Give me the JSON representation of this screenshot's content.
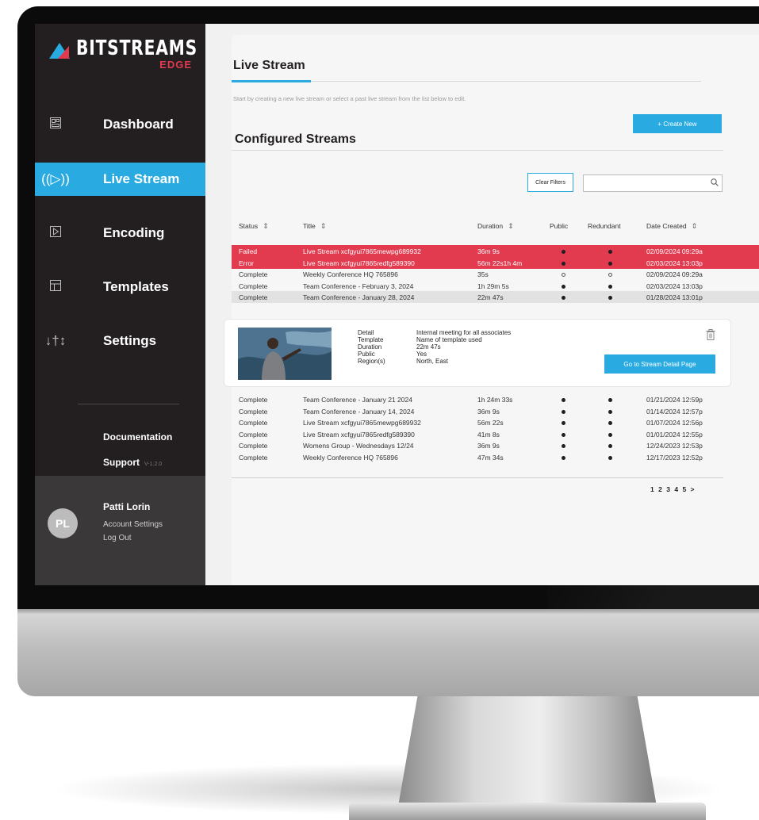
{
  "brand": {
    "name": "BITSTREAMS",
    "sub": "EDGE"
  },
  "nav": [
    {
      "label": "Dashboard",
      "icon": "dashboard-icon"
    },
    {
      "label": "Live Stream",
      "icon": "broadcast-icon"
    },
    {
      "label": "Encoding",
      "icon": "play-icon"
    },
    {
      "label": "Templates",
      "icon": "templates-icon"
    },
    {
      "label": "Settings",
      "icon": "sliders-icon"
    }
  ],
  "sidebar_links": {
    "documentation": "Documentation",
    "support": "Support",
    "version": "V-1.2.0"
  },
  "user": {
    "initials": "PL",
    "name": "Patti Lorin",
    "account_settings": "Account Settings",
    "logout": "Log Out"
  },
  "page": {
    "title": "Live Stream",
    "intro": "Start by creating a new live stream or select a past live stream from the list below to edit.",
    "create_button": "+ Create New",
    "section_title": "Configured Streams",
    "clear_filters": "Clear Filters",
    "search_placeholder": ""
  },
  "table": {
    "columns": [
      "Status",
      "Title",
      "Duration",
      "Public",
      "Redundant",
      "Date Created"
    ],
    "rows": [
      {
        "status": "Failed",
        "title": "Live Stream xcfgyui7865mewpg689932",
        "duration": "36m 9s",
        "public": "filled",
        "redundant": "filled",
        "date": "02/09/2024  09:29a",
        "state": "error"
      },
      {
        "status": "Error",
        "title": "Live Stream xcfgyui7865redfg589390",
        "duration": "56m 22s1h 4m",
        "public": "filled",
        "redundant": "filled",
        "date": "02/03/2024 13:03p",
        "state": "error"
      },
      {
        "status": "Complete",
        "title": "Weekly Conference HQ 765896",
        "duration": "35s",
        "public": "hollow",
        "redundant": "hollow",
        "date": "02/09/2024  09:29a",
        "state": "normal"
      },
      {
        "status": "Complete",
        "title": "Team Conference - February 3, 2024",
        "duration": "1h 29m 5s",
        "public": "filled",
        "redundant": "filled",
        "date": "02/03/2024 13:03p",
        "state": "normal"
      },
      {
        "status": "Complete",
        "title": "Team Conference - January 28, 2024",
        "duration": "22m 47s",
        "public": "filled",
        "redundant": "filled",
        "date": "01/28/2024 13:01p",
        "state": "selected"
      }
    ],
    "rows_after": [
      {
        "status": "Complete",
        "title": "Team Conference - January 21 2024",
        "duration": "1h 24m 33s",
        "public": "filled",
        "redundant": "filled",
        "date": "01/21/2024 12:59p"
      },
      {
        "status": "Complete",
        "title": "Team Conference - January 14, 2024",
        "duration": "36m 9s",
        "public": "filled",
        "redundant": "filled",
        "date": "01/14/2024 12:57p"
      },
      {
        "status": "Complete",
        "title": "Live Stream xcfgyui7865mewpg689932",
        "duration": "56m 22s",
        "public": "filled",
        "redundant": "filled",
        "date": "01/07/2024 12:56p"
      },
      {
        "status": "Complete",
        "title": "Live Stream xcfgyui7865redfg589390",
        "duration": "41m 8s",
        "public": "filled",
        "redundant": "filled",
        "date": "01/01/2024 12:55p"
      },
      {
        "status": "Complete",
        "title": "Womens Group - Wednesdays 12/24",
        "duration": "36m 9s",
        "public": "filled",
        "redundant": "filled",
        "date": "12/24/2023 12:53p"
      },
      {
        "status": "Complete",
        "title": "Weekly Conference HQ 765896",
        "duration": "47m 34s",
        "public": "filled",
        "redundant": "filled",
        "date": "12/17/2023 12:52p"
      }
    ]
  },
  "detail": {
    "fields": [
      {
        "key": "Detail",
        "value": "Internal meeting for all associates"
      },
      {
        "key": "Template",
        "value": "Name of template used"
      },
      {
        "key": "Duration",
        "value": "22m 47s"
      },
      {
        "key": "Public",
        "value": "Yes"
      },
      {
        "key": "Region(s)",
        "value": "North, East"
      }
    ],
    "button": "Go to Stream Detail Page"
  },
  "pagination": {
    "pages": [
      "1",
      "2",
      "3",
      "4",
      "5"
    ],
    "next": ">"
  },
  "colors": {
    "accent": "#29abe2",
    "error": "#e23a4e",
    "sidebar": "#231f20"
  }
}
